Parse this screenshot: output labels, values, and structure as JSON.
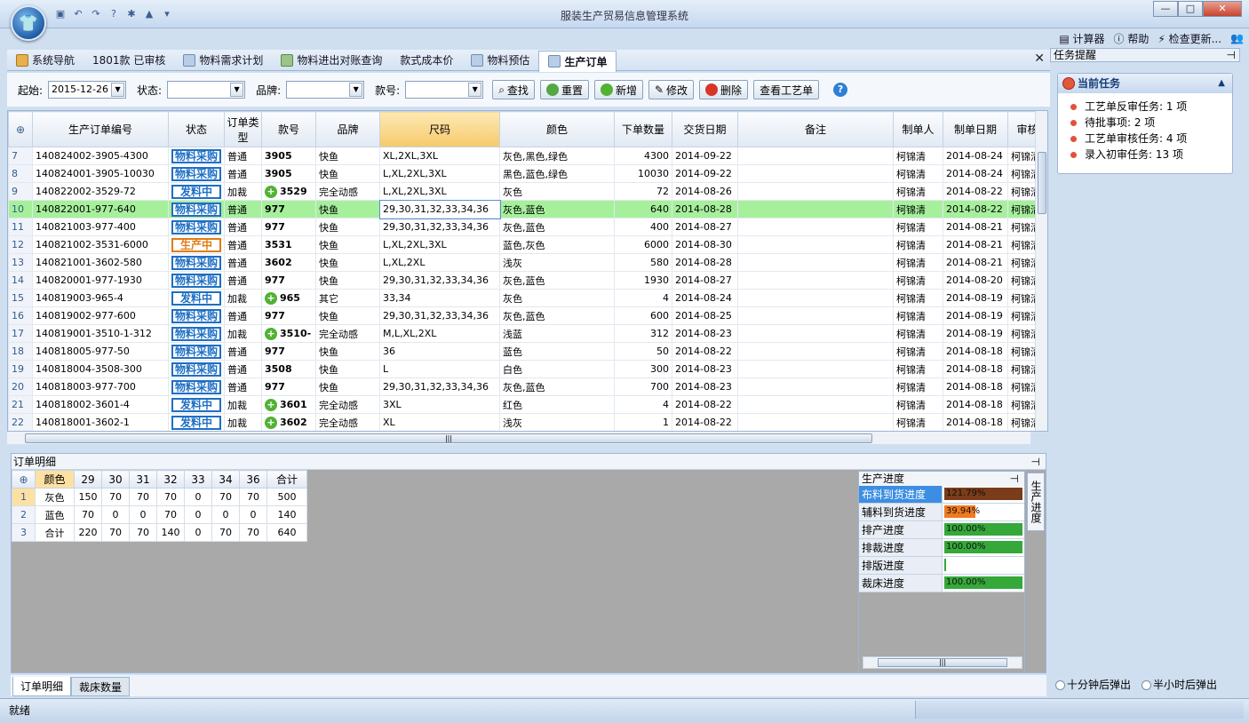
{
  "app": {
    "title": "服装生产贸易信息管理系统"
  },
  "window_controls": {
    "minimize": "—",
    "maximize": "□",
    "close": "✕"
  },
  "tools": [
    {
      "label": "计算器",
      "icon": "calculator-icon"
    },
    {
      "label": "帮助",
      "icon": "help-icon"
    },
    {
      "label": "检查更新...",
      "icon": "update-icon"
    }
  ],
  "tabs": [
    {
      "label": "系统导航"
    },
    {
      "label": "1801款 已审核"
    },
    {
      "label": "物料需求计划"
    },
    {
      "label": "物料进出对账查询"
    },
    {
      "label": "款式成本价"
    },
    {
      "label": "物料预估"
    },
    {
      "label": "生产订单"
    }
  ],
  "filters": {
    "start_label": "起始:",
    "start_value": "2015-12-26",
    "status_label": "状态:",
    "status_value": "",
    "brand_label": "品牌:",
    "brand_value": "",
    "style_label": "款号:",
    "style_value": ""
  },
  "buttons": {
    "search": "查找",
    "reset": "重置",
    "add": "新增",
    "edit": "修改",
    "delete": "删除",
    "view_process": "查看工艺单"
  },
  "table": {
    "columns": [
      "生产订单编号",
      "状态",
      "订单类型",
      "款号",
      "品牌",
      "尺码",
      "颜色",
      "下单数量",
      "交货日期",
      "备注",
      "制单人",
      "制单日期",
      "审核"
    ],
    "rows": [
      {
        "n": "7",
        "id": "140824002-3905-4300",
        "status": "物料采购",
        "type": "普通",
        "style": "3905",
        "plus": false,
        "brand": "快鱼",
        "size": "XL,2XL,3XL",
        "color": "灰色,黑色,绿色",
        "qty": "4300",
        "due": "2014-09-22",
        "note": "",
        "maker": "柯锦清",
        "mdate": "2014-08-24",
        "audit": "柯锦清"
      },
      {
        "n": "8",
        "id": "140824001-3905-10030",
        "status": "物料采购",
        "type": "普通",
        "style": "3905",
        "plus": false,
        "brand": "快鱼",
        "size": "L,XL,2XL,3XL",
        "color": "黑色,蓝色,绿色",
        "qty": "10030",
        "due": "2014-09-22",
        "note": "",
        "maker": "柯锦清",
        "mdate": "2014-08-24",
        "audit": "柯锦清"
      },
      {
        "n": "9",
        "id": "140822002-3529-72",
        "status": "发料中",
        "type": "加裁",
        "style": "3529",
        "plus": true,
        "brand": "完全动感",
        "size": "L,XL,2XL,3XL",
        "color": "灰色",
        "qty": "72",
        "due": "2014-08-26",
        "note": "",
        "maker": "柯锦清",
        "mdate": "2014-08-22",
        "audit": "柯锦清"
      },
      {
        "n": "10",
        "id": "140822001-977-640",
        "status": "物料采购",
        "type": "普通",
        "style": "977",
        "plus": false,
        "brand": "快鱼",
        "size": "29,30,31,32,33,34,36",
        "color": "灰色,蓝色",
        "qty": "640",
        "due": "2014-08-28",
        "note": "",
        "maker": "柯锦清",
        "mdate": "2014-08-22",
        "audit": "柯锦清"
      },
      {
        "n": "11",
        "id": "140821003-977-400",
        "status": "物料采购",
        "type": "普通",
        "style": "977",
        "plus": false,
        "brand": "快鱼",
        "size": "29,30,31,32,33,34,36",
        "color": "灰色,蓝色",
        "qty": "400",
        "due": "2014-08-27",
        "note": "",
        "maker": "柯锦清",
        "mdate": "2014-08-21",
        "audit": "柯锦清"
      },
      {
        "n": "12",
        "id": "140821002-3531-6000",
        "status": "生产中",
        "type": "普通",
        "style": "3531",
        "plus": false,
        "brand": "快鱼",
        "size": "L,XL,2XL,3XL",
        "color": "蓝色,灰色",
        "qty": "6000",
        "due": "2014-08-30",
        "note": "",
        "maker": "柯锦清",
        "mdate": "2014-08-21",
        "audit": "柯锦清"
      },
      {
        "n": "13",
        "id": "140821001-3602-580",
        "status": "物料采购",
        "type": "普通",
        "style": "3602",
        "plus": false,
        "brand": "快鱼",
        "size": "L,XL,2XL",
        "color": "浅灰",
        "qty": "580",
        "due": "2014-08-28",
        "note": "",
        "maker": "柯锦清",
        "mdate": "2014-08-21",
        "audit": "柯锦清"
      },
      {
        "n": "14",
        "id": "140820001-977-1930",
        "status": "物料采购",
        "type": "普通",
        "style": "977",
        "plus": false,
        "brand": "快鱼",
        "size": "29,30,31,32,33,34,36",
        "color": "灰色,蓝色",
        "qty": "1930",
        "due": "2014-08-27",
        "note": "",
        "maker": "柯锦清",
        "mdate": "2014-08-20",
        "audit": "柯锦清"
      },
      {
        "n": "15",
        "id": "140819003-965-4",
        "status": "发料中",
        "type": "加裁",
        "style": "965",
        "plus": true,
        "brand": "其它",
        "size": "33,34",
        "color": "灰色",
        "qty": "4",
        "due": "2014-08-24",
        "note": "",
        "maker": "柯锦清",
        "mdate": "2014-08-19",
        "audit": "柯锦清"
      },
      {
        "n": "16",
        "id": "140819002-977-600",
        "status": "物料采购",
        "type": "普通",
        "style": "977",
        "plus": false,
        "brand": "快鱼",
        "size": "29,30,31,32,33,34,36",
        "color": "灰色,蓝色",
        "qty": "600",
        "due": "2014-08-25",
        "note": "",
        "maker": "柯锦清",
        "mdate": "2014-08-19",
        "audit": "柯锦清"
      },
      {
        "n": "17",
        "id": "140819001-3510-1-312",
        "status": "物料采购",
        "type": "加裁",
        "style": "3510-",
        "plus": true,
        "brand": "完全动感",
        "size": "M,L,XL,2XL",
        "color": "浅蓝",
        "qty": "312",
        "due": "2014-08-23",
        "note": "",
        "maker": "柯锦清",
        "mdate": "2014-08-19",
        "audit": "柯锦清"
      },
      {
        "n": "18",
        "id": "140818005-977-50",
        "status": "物料采购",
        "type": "普通",
        "style": "977",
        "plus": false,
        "brand": "快鱼",
        "size": "36",
        "color": "蓝色",
        "qty": "50",
        "due": "2014-08-22",
        "note": "",
        "maker": "柯锦清",
        "mdate": "2014-08-18",
        "audit": "柯锦清"
      },
      {
        "n": "19",
        "id": "140818004-3508-300",
        "status": "物料采购",
        "type": "普通",
        "style": "3508",
        "plus": false,
        "brand": "快鱼",
        "size": "L",
        "color": "白色",
        "qty": "300",
        "due": "2014-08-23",
        "note": "",
        "maker": "柯锦清",
        "mdate": "2014-08-18",
        "audit": "柯锦清"
      },
      {
        "n": "20",
        "id": "140818003-977-700",
        "status": "物料采购",
        "type": "普通",
        "style": "977",
        "plus": false,
        "brand": "快鱼",
        "size": "29,30,31,32,33,34,36",
        "color": "灰色,蓝色",
        "qty": "700",
        "due": "2014-08-23",
        "note": "",
        "maker": "柯锦清",
        "mdate": "2014-08-18",
        "audit": "柯锦清"
      },
      {
        "n": "21",
        "id": "140818002-3601-4",
        "status": "发料中",
        "type": "加裁",
        "style": "3601",
        "plus": true,
        "brand": "完全动感",
        "size": "3XL",
        "color": "红色",
        "qty": "4",
        "due": "2014-08-22",
        "note": "",
        "maker": "柯锦清",
        "mdate": "2014-08-18",
        "audit": "柯锦清"
      },
      {
        "n": "22",
        "id": "140818001-3602-1",
        "status": "发料中",
        "type": "加裁",
        "style": "3602",
        "plus": true,
        "brand": "完全动感",
        "size": "XL",
        "color": "浅灰",
        "qty": "1",
        "due": "2014-08-22",
        "note": "",
        "maker": "柯锦清",
        "mdate": "2014-08-18",
        "audit": "柯锦清"
      }
    ]
  },
  "detail": {
    "title": "订单明细",
    "columns": [
      "颜色",
      "29",
      "30",
      "31",
      "32",
      "33",
      "34",
      "36",
      "合计"
    ],
    "rows": [
      {
        "n": "1",
        "cells": [
          "灰色",
          "150",
          "70",
          "70",
          "70",
          "0",
          "70",
          "70",
          "500"
        ]
      },
      {
        "n": "2",
        "cells": [
          "蓝色",
          "70",
          "0",
          "0",
          "70",
          "0",
          "0",
          "0",
          "140"
        ]
      },
      {
        "n": "3",
        "cells": [
          "合计",
          "220",
          "70",
          "70",
          "140",
          "0",
          "70",
          "70",
          "640"
        ]
      }
    ]
  },
  "progress": {
    "title": "生产进度",
    "vertical_tab": "生产进度",
    "rows": [
      {
        "label": "布料到货进度",
        "text": "121.79%",
        "pct": 100,
        "color": "#7a3c1a"
      },
      {
        "label": "辅料到货进度",
        "text": "39.94%",
        "pct": 39.94,
        "color": "#f07a20"
      },
      {
        "label": "排产进度",
        "text": "100.00%",
        "pct": 100,
        "color": "#35a83a"
      },
      {
        "label": "排裁进度",
        "text": "100.00%",
        "pct": 100,
        "color": "#35a83a"
      },
      {
        "label": "排版进度",
        "text": "",
        "pct": 0,
        "color": "#35a83a"
      },
      {
        "label": "裁床进度",
        "text": "100.00%",
        "pct": 100,
        "color": "#35a83a"
      }
    ]
  },
  "bottom_tabs": [
    "订单明细",
    "裁床数量"
  ],
  "right": {
    "header": "任务提醒",
    "current_tasks": "当前任务",
    "tasks": [
      "工艺单反审任务: 1 项",
      "待批事项: 2 项",
      "工艺单审核任务: 4 项",
      "录入初审任务: 13 项"
    ],
    "radio1": "十分钟后弹出",
    "radio2": "半小时后弹出"
  },
  "status": {
    "text": "就绪"
  }
}
